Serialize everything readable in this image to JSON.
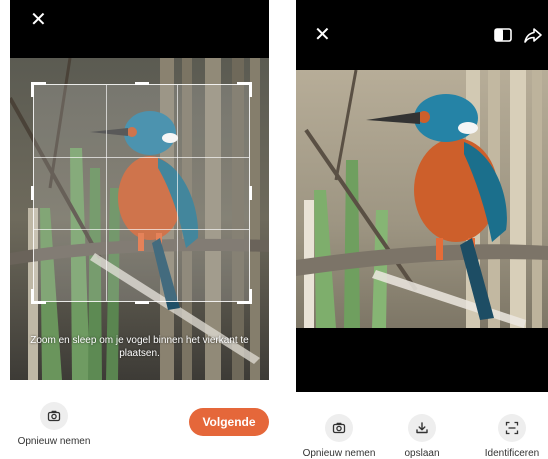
{
  "colors": {
    "accent": "#e5673a",
    "background": "#000000",
    "icon_circle": "#eeeeee"
  },
  "crop_screen": {
    "close_icon": "close-icon",
    "hint": "Zoom en sleep om je vogel binnen het vierkant te plaatsen.",
    "retake_label": "Opnieuw nemen",
    "next_label": "Volgende"
  },
  "result_screen": {
    "close_icon": "close-icon",
    "compare_icon": "compare-icon",
    "share_icon": "share-icon",
    "actions": [
      {
        "label": "Opnieuw nemen",
        "icon": "camera-icon"
      },
      {
        "label": "opslaan",
        "icon": "download-icon"
      },
      {
        "label": "Identificeren",
        "icon": "scan-icon"
      }
    ]
  }
}
